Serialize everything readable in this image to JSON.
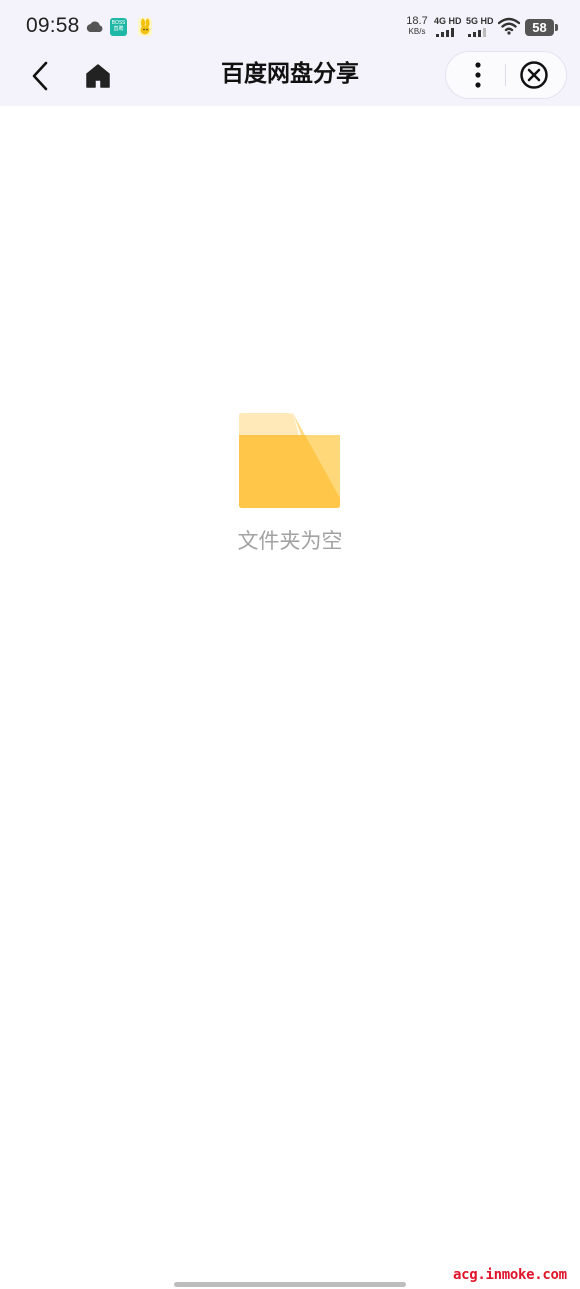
{
  "status_bar": {
    "time": "09:58",
    "net_speed_value": "18.7",
    "net_speed_unit": "KB/s",
    "sim1_label": "4G HD",
    "sim2_label": "5G HD",
    "battery_level": "58",
    "icons": [
      "cloud-icon",
      "boss-app-icon",
      "rabbit-app-icon",
      "signal-icon",
      "wifi-icon",
      "battery-icon"
    ]
  },
  "nav": {
    "title": "百度网盘分享",
    "icons": [
      "back-icon",
      "home-icon",
      "more-icon",
      "close-icon"
    ]
  },
  "empty_state": {
    "icon": "folder-icon",
    "message": "文件夹为空"
  },
  "watermark": "acg.inmoke.com",
  "colors": {
    "nav_background": "#f4f3fb",
    "folder_main": "#ffc64a",
    "folder_back": "#ffe9b8",
    "empty_text": "#a2a2a2",
    "watermark": "#e0142a"
  }
}
